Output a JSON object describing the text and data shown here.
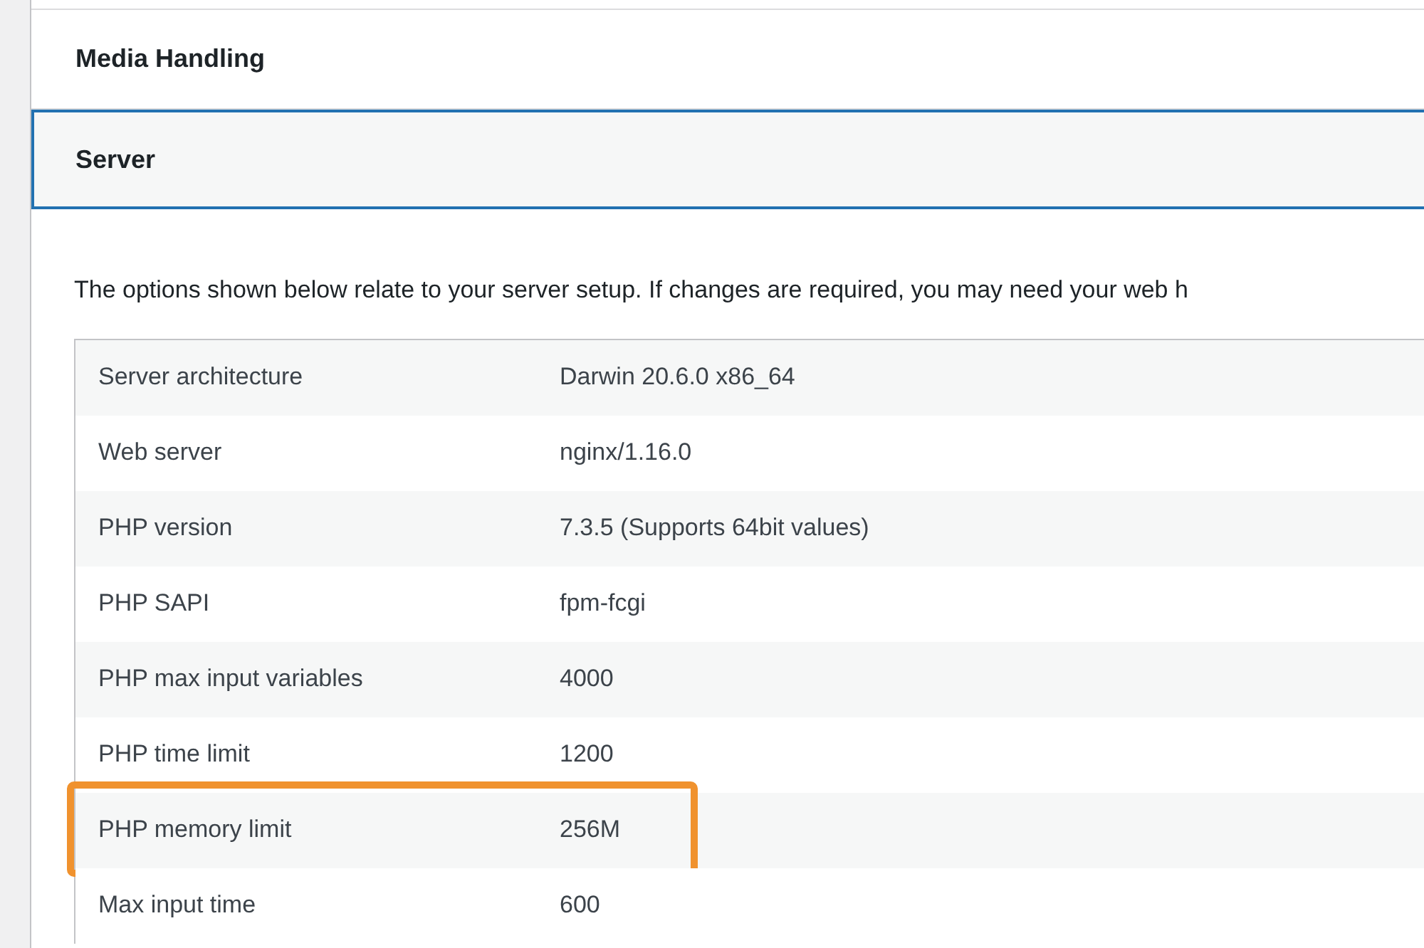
{
  "sections": [
    {
      "title": "Media Handling",
      "expanded": false
    },
    {
      "title": "Server",
      "expanded": true
    }
  ],
  "description": "The options shown below relate to your server setup. If changes are required, you may need your web h",
  "table": {
    "rows": [
      {
        "label": "Server architecture",
        "value": "Darwin 20.6.0 x86_64",
        "highlighted": false
      },
      {
        "label": "Web server",
        "value": "nginx/1.16.0",
        "highlighted": false
      },
      {
        "label": "PHP version",
        "value": "7.3.5 (Supports 64bit values)",
        "highlighted": false
      },
      {
        "label": "PHP SAPI",
        "value": "fpm-fcgi",
        "highlighted": false
      },
      {
        "label": "PHP max input variables",
        "value": "4000",
        "highlighted": false
      },
      {
        "label": "PHP time limit",
        "value": "1200",
        "highlighted": false
      },
      {
        "label": "PHP memory limit",
        "value": "256M",
        "highlighted": true
      },
      {
        "label": "Max input time",
        "value": "600",
        "highlighted": false
      }
    ]
  }
}
